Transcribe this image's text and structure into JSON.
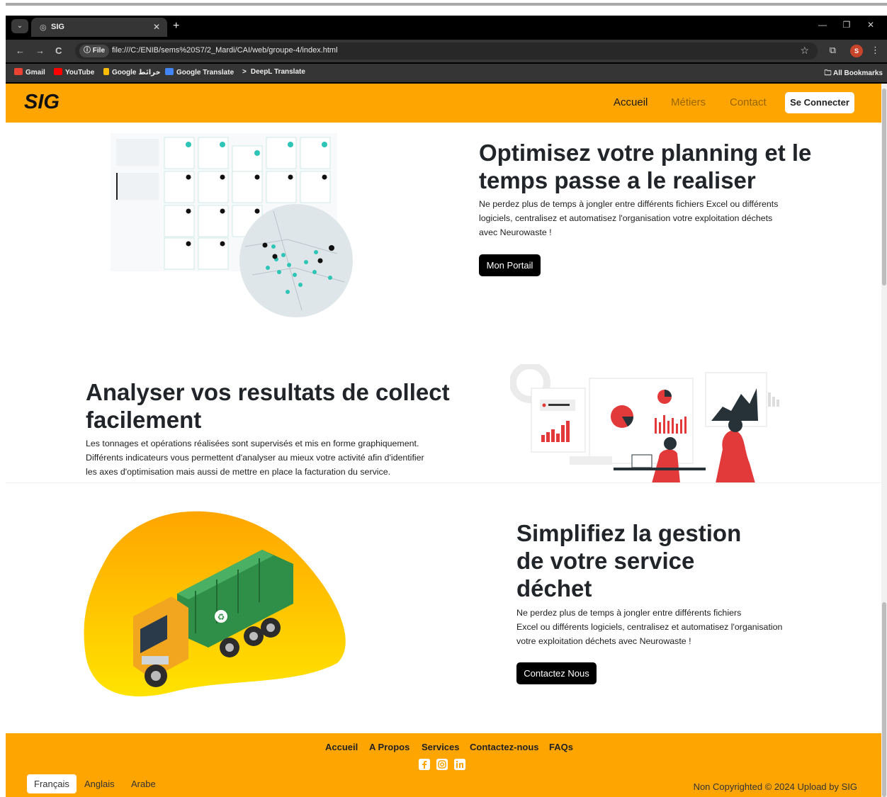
{
  "browser": {
    "tab_title": "SIG",
    "url_chip": "File",
    "url": "file:///C:/ENIB/sems%20S7/2_Mardi/CAI/web/groupe-4/index.html",
    "profile_initial": "S",
    "bookmarks": [
      {
        "label": "Gmail",
        "icon_color": "#ea4335"
      },
      {
        "label": "YouTube",
        "icon_color": "#ff0000"
      },
      {
        "label": "Google خرائط",
        "icon_color": "#fbbc04"
      },
      {
        "label": "Google Translate",
        "icon_color": "#4285f4"
      },
      {
        "label": "DeepL Translate",
        "icon_color": "#0f2b46"
      }
    ],
    "all_bookmarks": "All Bookmarks"
  },
  "navbar": {
    "brand": "SIG",
    "links": [
      "Accueil",
      "Métiers",
      "Contact"
    ],
    "connect_label": "Se Connecter"
  },
  "sections": [
    {
      "heading_line1": "Optimisez votre planning et le",
      "heading_line2": "temps passe a le realiser",
      "text_line1": "Ne perdez plus de temps à jongler entre différents fichiers Excel ou différents",
      "text_line2": "logiciels, centralisez et automatisez l'organisation votre exploitation déchets",
      "text_line3": "avec Neurowaste !",
      "button": "Mon Portail"
    },
    {
      "heading_line1": "Analyser vos resultats de collect",
      "heading_line2": "facilement",
      "text_line1": "Les tonnages et opérations réalisées sont supervisés et mis en forme graphiquement.",
      "text_line2": "Différents indicateurs vous permettent d'analyser au mieux votre activité afin d'identifier",
      "text_line3": "les axes d'optimisation mais aussi de mettre en place la facturation du service."
    },
    {
      "heading_line1": "Simplifiez la gestion",
      "heading_line2": "de votre service",
      "heading_line3": "déchet",
      "text_line1": "Ne perdez plus de temps à jongler entre différents fichiers",
      "text_line2": "Excel ou différents logiciels, centralisez et automatisez l'organisation",
      "text_line3": "votre exploitation déchets avec Neurowaste !",
      "button": "Contactez Nous"
    }
  ],
  "footer": {
    "links": [
      "Accueil",
      "A Propos",
      "Services",
      "Contactez-nous",
      "FAQs"
    ],
    "social_icons": [
      "facebook-icon",
      "instagram-icon",
      "linkedin-icon"
    ],
    "languages": [
      "Français",
      "Anglais",
      "Arabe"
    ],
    "copyright": "Non Copyrighted © 2024 Upload by SIG"
  },
  "colors": {
    "brand": "#ffa502",
    "dark_button": "#000000",
    "teal_marker": "#2ec4b6"
  }
}
